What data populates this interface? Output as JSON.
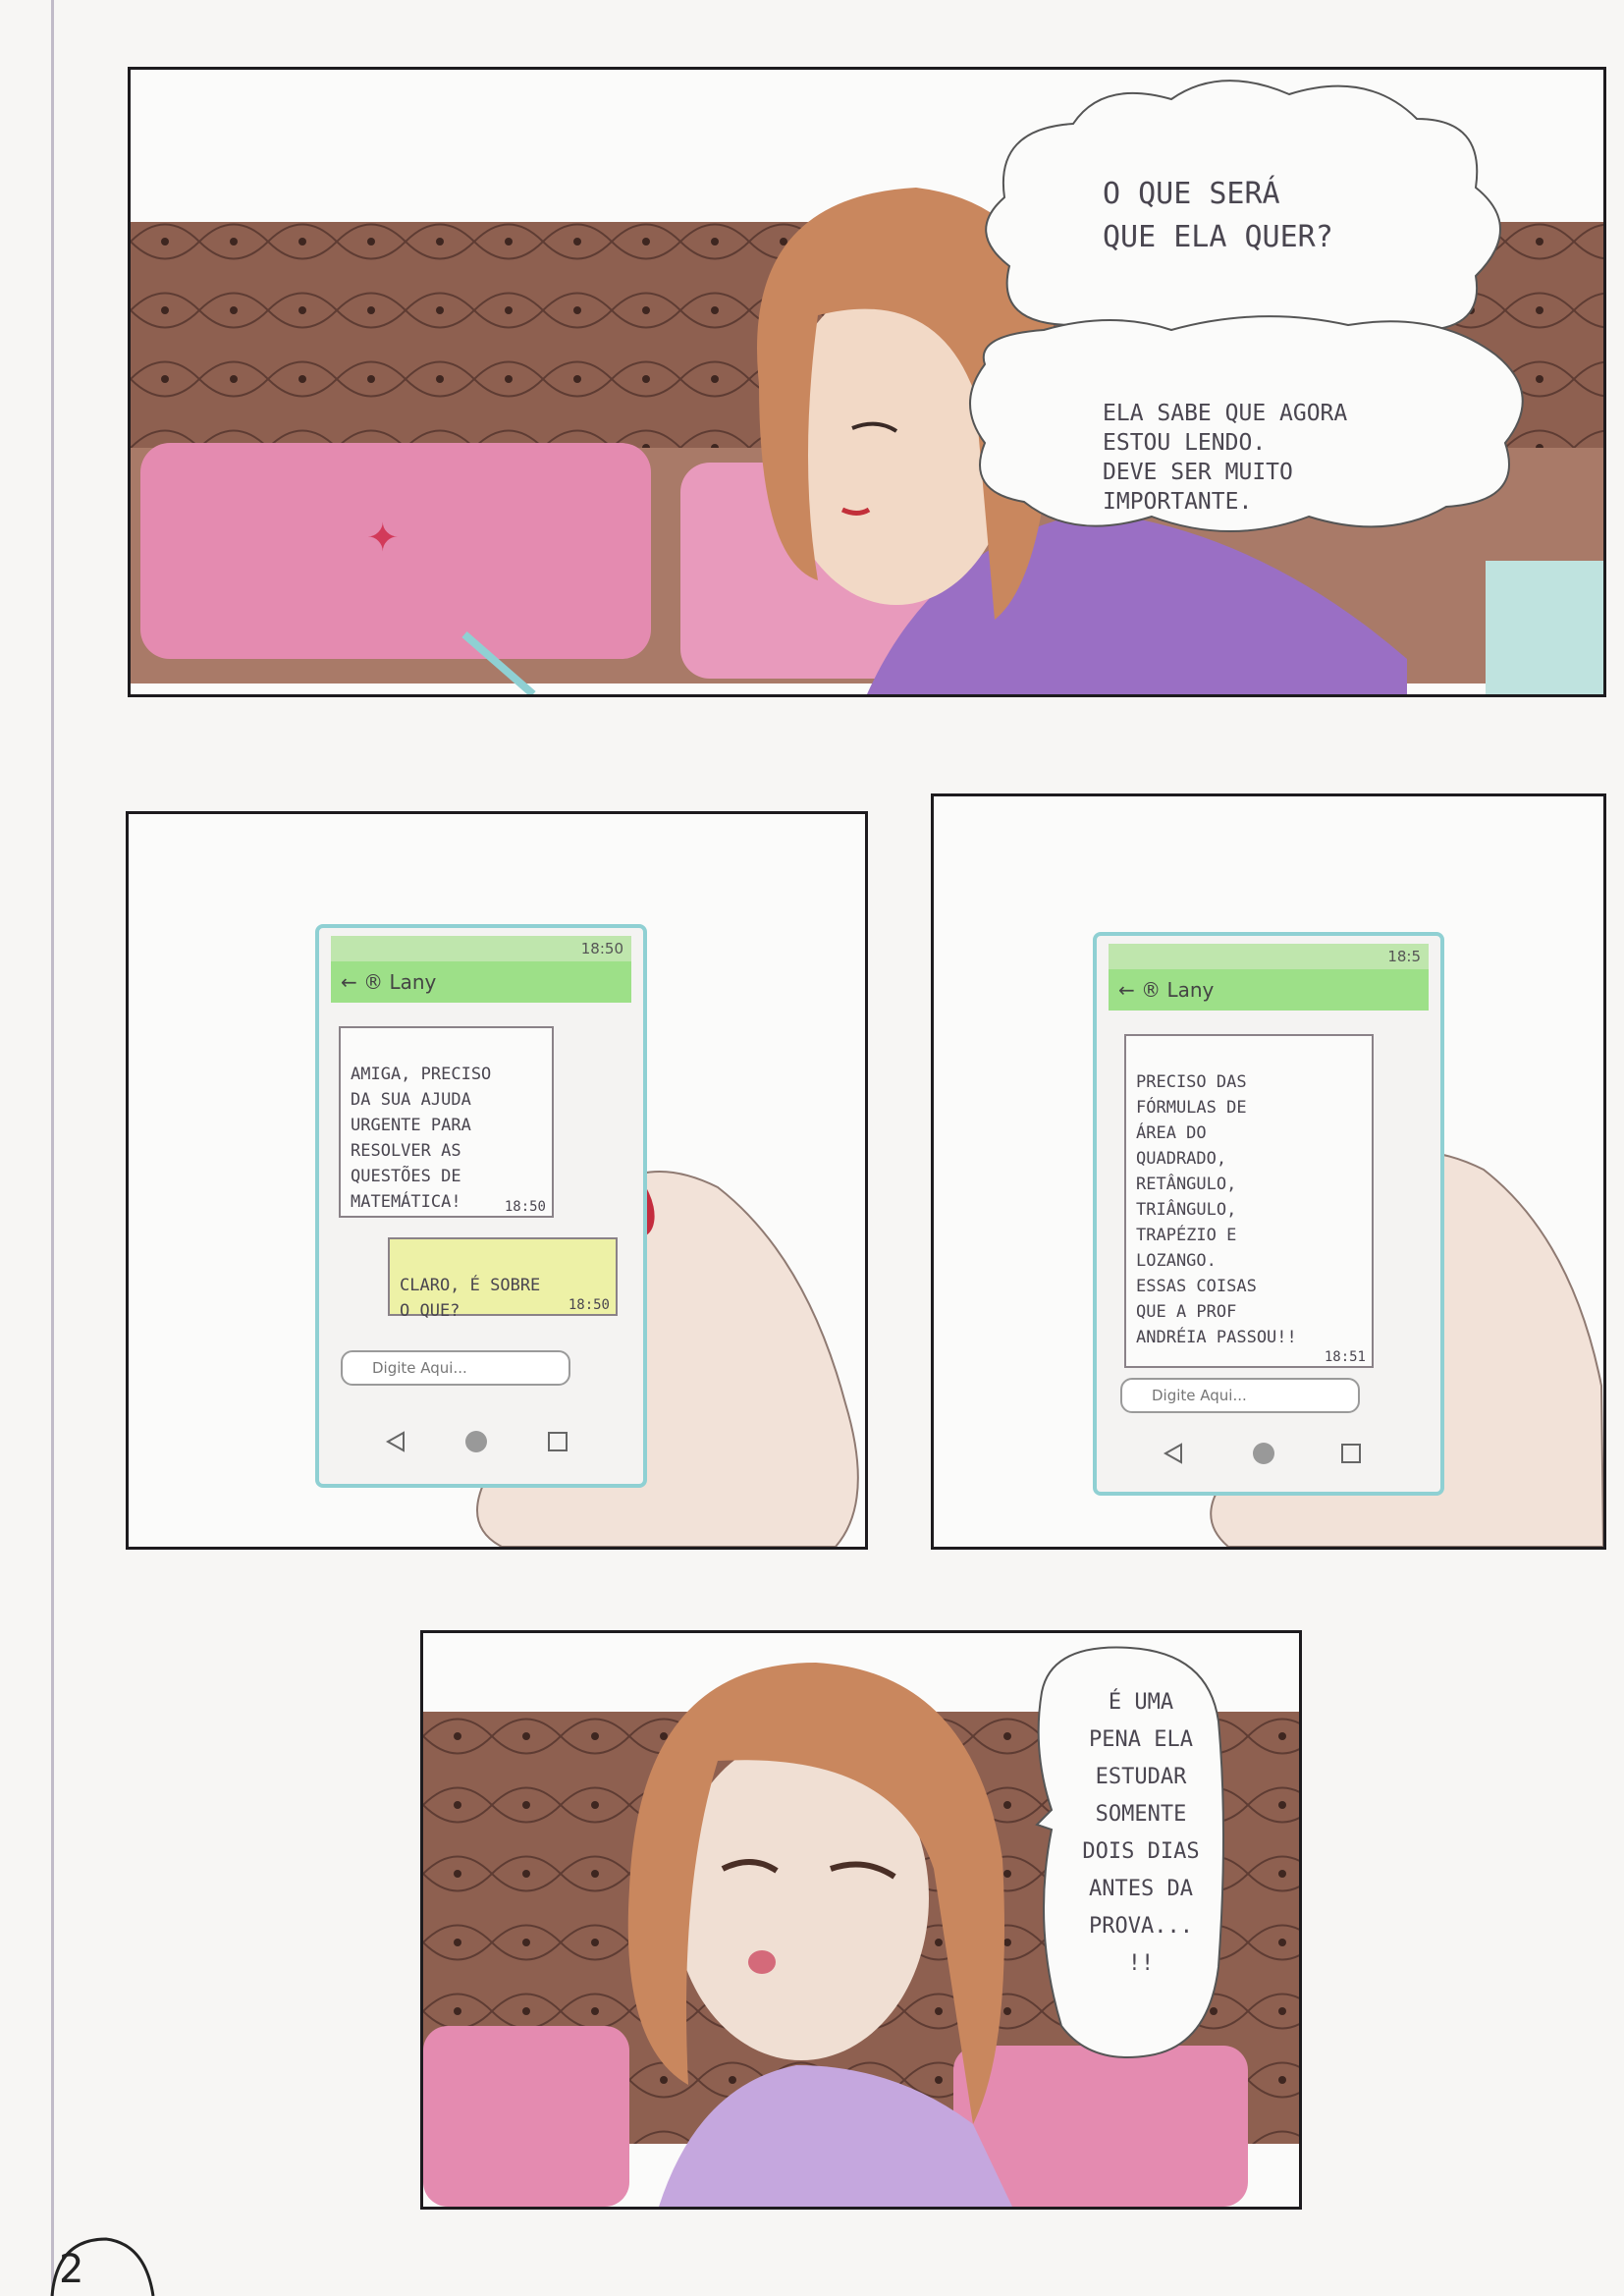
{
  "page": {
    "number": "2"
  },
  "panel1": {
    "bubble1": "O que será\nque ela quer?",
    "bubble2": "Ela sabe que agora\nestou lendo.\nDeve ser muito\nimportante."
  },
  "panel2": {
    "phone": {
      "status": "18:50",
      "contact": "Lany",
      "message": "Amiga, preciso\nda sua ajuda\nurgente para\nresolver as\nquestões de\nmatemática!",
      "message_time": "18:50",
      "reply": "Claro, é sobre\no que?",
      "reply_time": "18:50",
      "input_placeholder": "Digite Aqui..."
    }
  },
  "panel3": {
    "phone": {
      "status": "18:5",
      "contact": "Lany",
      "message": "Preciso das\nfórmulas de\nárea do\nquadrado,\nretângulo,\ntriângulo,\ntrapézio e\nlozango.\nEssas coisas\nque a prof\nAndréia passou!!",
      "message_time": "18:51",
      "input_placeholder": "Digite Aqui..."
    }
  },
  "panel4": {
    "bubble": "É uma\npena ela\nestudar\nsomente\ndois dias\nantes da\nprova...\n!!"
  },
  "colors": {
    "sofa_brown": "#8a5a48",
    "cushion_pink": "#e48bb0",
    "hair": "#c9875e",
    "sweater": "#9a6fc4",
    "phone_frame": "#8fd0d3",
    "chat_green": "#9de088"
  }
}
